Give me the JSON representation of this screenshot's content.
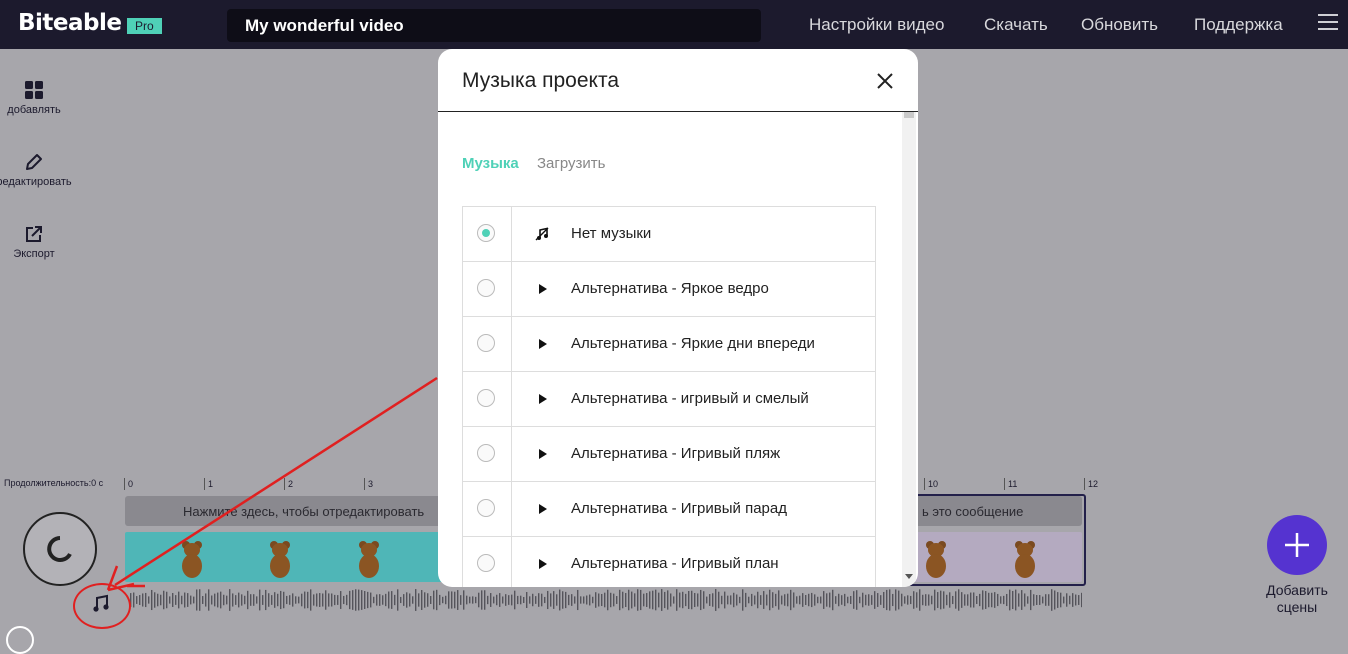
{
  "topbar": {
    "logo": "Biteable",
    "badge": "Pro",
    "video_title": "My wonderful video",
    "nav": [
      "Настройки видео",
      "Скачать",
      "Обновить",
      "Поддержка"
    ]
  },
  "tools": [
    {
      "label": "добавлять",
      "icon": "grid-icon"
    },
    {
      "label": "редактировать",
      "icon": "pencil-icon"
    },
    {
      "label": "Экспорт",
      "icon": "export-icon"
    }
  ],
  "timeline": {
    "duration_label": "Продолжительность:0 с",
    "ticks": [
      "0",
      "1",
      "2",
      "3",
      "10",
      "11",
      "12"
    ],
    "scene_left_text": "Нажмите здесь, чтобы отредактировать",
    "scene_right_text": "ь это сообщение",
    "add_scene_label": "Добавить сцены"
  },
  "modal": {
    "title": "Музыка проекта",
    "tabs": {
      "music": "Музыка",
      "upload": "Загрузить"
    },
    "tracks": [
      {
        "label": "Нет музыки",
        "selected": true,
        "icon": "no-music-icon"
      },
      {
        "label": "Альтернатива - Яркое ведро",
        "selected": false,
        "icon": "play-icon"
      },
      {
        "label": "Альтернатива - Яркие дни впереди",
        "selected": false,
        "icon": "play-icon"
      },
      {
        "label": "Альтернатива - игривый и смелый",
        "selected": false,
        "icon": "play-icon"
      },
      {
        "label": "Альтернатива - Игривый пляж",
        "selected": false,
        "icon": "play-icon"
      },
      {
        "label": "Альтернатива - Игривый парад",
        "selected": false,
        "icon": "play-icon"
      },
      {
        "label": "Альтернатива - Игривый план",
        "selected": false,
        "icon": "play-icon"
      }
    ]
  },
  "colors": {
    "accent": "#4fd1b7",
    "topbar": "#1c1a2d",
    "add_button": "#5533d0",
    "annotation": "#e02020"
  }
}
